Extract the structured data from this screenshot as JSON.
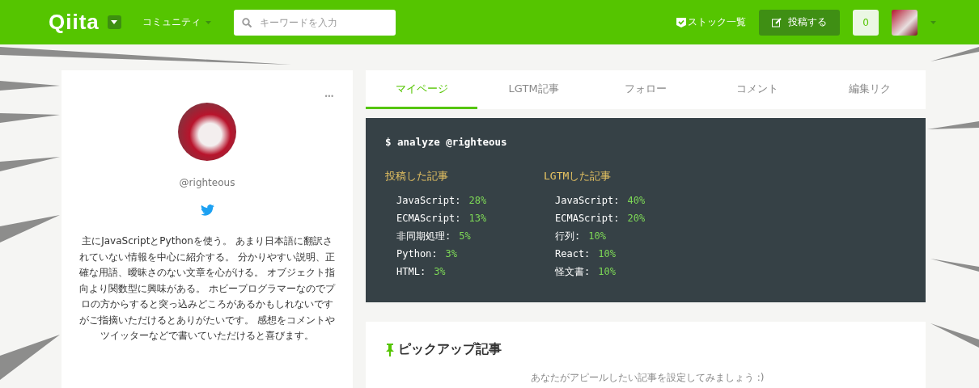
{
  "header": {
    "logo": "Qiita",
    "community": "コミュニティ",
    "search": {
      "placeholder": "キーワードを入力"
    },
    "stock_link": "ストック一覧",
    "post_button": "投稿する",
    "notifications": "0"
  },
  "profile": {
    "more": "•••",
    "username": "@righteous",
    "bio": "主にJavaScriptとPythonを使う。 あまり日本語に翻訳されていない情報を中心に紹介する。 分かりやすい説明、正確な用語、曖昧さのない文章を心がける。 オブジェクト指向より関数型に興味がある。 ホビープログラマーなのでプロの方からすると突っ込みどころがあるかもしれないですがご指摘いただけるとありがたいです。 感想をコメントやツイッターなどで書いていただけると喜びます。"
  },
  "tabs": [
    {
      "label": "マイページ",
      "selected": true
    },
    {
      "label": "LGTM記事",
      "selected": false
    },
    {
      "label": "フォロー",
      "selected": false
    },
    {
      "label": "コメント",
      "selected": false
    },
    {
      "label": "編集リク",
      "selected": false
    }
  ],
  "analysis": {
    "command": "$ analyze @righteous",
    "columns": [
      {
        "title": "投稿した記事",
        "rows": [
          {
            "name": "JavaScript:",
            "value": "28%"
          },
          {
            "name": "ECMAScript:",
            "value": "13%"
          },
          {
            "name": "非同期処理:",
            "value": "5%"
          },
          {
            "name": "Python:",
            "value": "3%"
          },
          {
            "name": "HTML:",
            "value": "3%"
          }
        ]
      },
      {
        "title": "LGTMした記事",
        "rows": [
          {
            "name": "JavaScript:",
            "value": "40%"
          },
          {
            "name": "ECMAScript:",
            "value": "20%"
          },
          {
            "name": "行列:",
            "value": "10%"
          },
          {
            "name": "React:",
            "value": "10%"
          },
          {
            "name": "怪文書:",
            "value": "10%"
          }
        ]
      }
    ]
  },
  "pickup": {
    "title": "ピックアップ記事",
    "message": "あなたがアピールしたい記事を設定してみましょう :)"
  }
}
